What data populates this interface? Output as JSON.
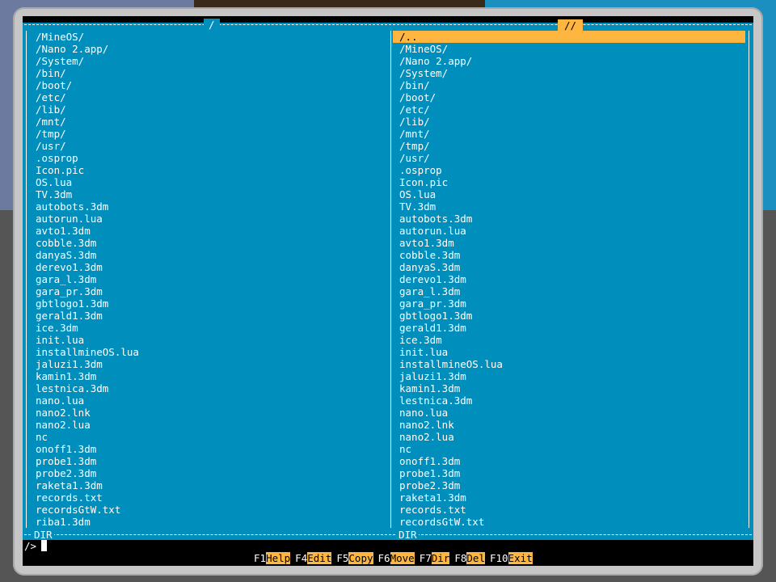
{
  "left_panel": {
    "title": "/",
    "footer": "DIR",
    "items": [
      "/MineOS/",
      "/Nano 2.app/",
      "/System/",
      "/bin/",
      "/boot/",
      "/etc/",
      "/lib/",
      "/mnt/",
      "/tmp/",
      "/usr/",
      ".osprop",
      "Icon.pic",
      "OS.lua",
      "TV.3dm",
      "autobots.3dm",
      "autorun.lua",
      "avto1.3dm",
      "cobble.3dm",
      "danyaS.3dm",
      "derevo1.3dm",
      "gara_l.3dm",
      "gara_pr.3dm",
      "gbtlogo1.3dm",
      "gerald1.3dm",
      "ice.3dm",
      "init.lua",
      "installmineOS.lua",
      "jaluzi1.3dm",
      "kamin1.3dm",
      "lestnica.3dm",
      "nano.lua",
      "nano2.lnk",
      "nano2.lua",
      "nc",
      "onoff1.3dm",
      "probe1.3dm",
      "probe2.3dm",
      "raketa1.3dm",
      "records.txt",
      "recordsGtW.txt",
      "riba1.3dm"
    ]
  },
  "right_panel": {
    "title": "//",
    "footer": "DIR",
    "selected_index": 0,
    "items": [
      "/..",
      "/MineOS/",
      "/Nano 2.app/",
      "/System/",
      "/bin/",
      "/boot/",
      "/etc/",
      "/lib/",
      "/mnt/",
      "/tmp/",
      "/usr/",
      ".osprop",
      "Icon.pic",
      "OS.lua",
      "TV.3dm",
      "autobots.3dm",
      "autorun.lua",
      "avto1.3dm",
      "cobble.3dm",
      "danyaS.3dm",
      "derevo1.3dm",
      "gara_l.3dm",
      "gara_pr.3dm",
      "gbtlogo1.3dm",
      "gerald1.3dm",
      "ice.3dm",
      "init.lua",
      "installmineOS.lua",
      "jaluzi1.3dm",
      "kamin1.3dm",
      "lestnica.3dm",
      "nano.lua",
      "nano2.lnk",
      "nano2.lua",
      "nc",
      "onoff1.3dm",
      "probe1.3dm",
      "probe2.3dm",
      "raketa1.3dm",
      "records.txt",
      "recordsGtW.txt"
    ]
  },
  "command_line": {
    "prompt": "/>",
    "value": ""
  },
  "function_keys": [
    {
      "key": "F1",
      "label": "Help"
    },
    {
      "key": "F4",
      "label": "Edit"
    },
    {
      "key": "F5",
      "label": "Copy"
    },
    {
      "key": "F6",
      "label": "Move"
    },
    {
      "key": "F7",
      "label": "Dir"
    },
    {
      "key": "F8",
      "label": "Del"
    },
    {
      "key": "F10",
      "label": "Exit"
    }
  ],
  "colors": {
    "panel_bg": "#008fbd",
    "highlight": "#ffb640",
    "text": "#ffffff",
    "screen_bg": "#000000",
    "bezel": "#c6c6c6"
  }
}
